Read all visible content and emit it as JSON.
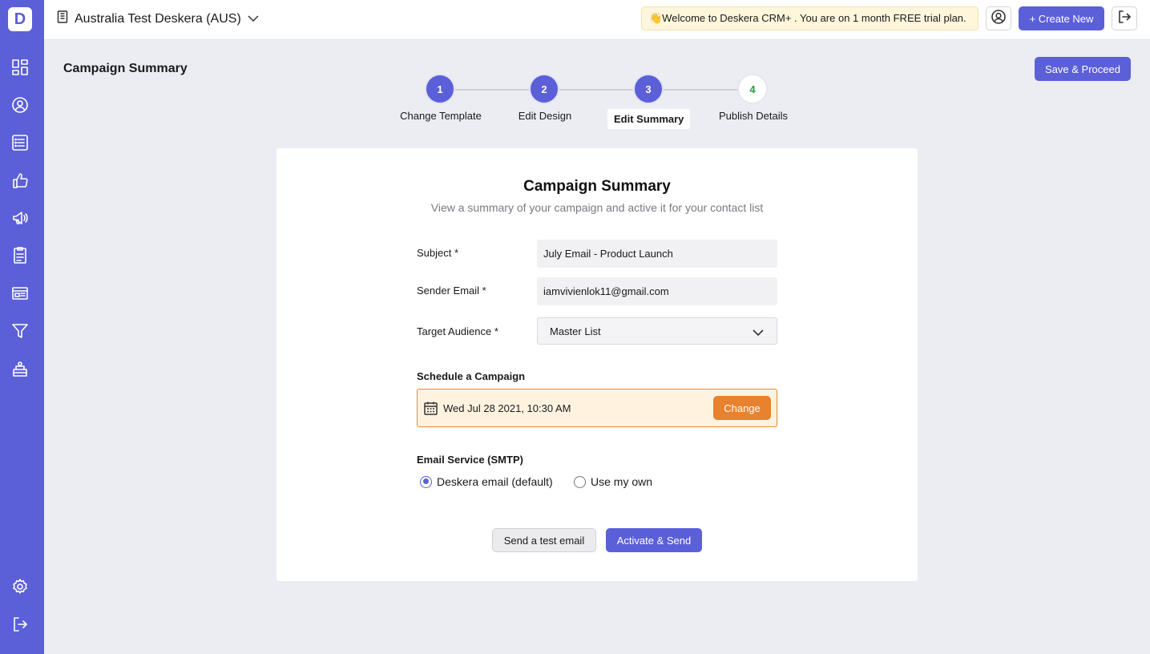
{
  "app": {
    "logo_letter": "D"
  },
  "sidebar": {
    "items": [
      {
        "name": "dashboard-icon"
      },
      {
        "name": "contacts-icon"
      },
      {
        "name": "list-icon"
      },
      {
        "name": "deals-icon"
      },
      {
        "name": "campaign-icon"
      },
      {
        "name": "forms-icon"
      },
      {
        "name": "landing-page-icon"
      },
      {
        "name": "funnel-icon"
      },
      {
        "name": "support-icon"
      },
      {
        "name": "settings-icon"
      },
      {
        "name": "logout-icon"
      }
    ]
  },
  "topbar": {
    "org_name": "Australia Test Deskera (AUS)",
    "banner": "👋Welcome to Deskera CRM+ . You are on 1 month FREE trial plan.",
    "create_label": "+ Create New"
  },
  "header": {
    "title": "Campaign Summary",
    "save_label": "Save & Proceed"
  },
  "stepper": {
    "steps": [
      {
        "num": "1",
        "label": "Change Template",
        "status": "done"
      },
      {
        "num": "2",
        "label": "Edit Design",
        "status": "done"
      },
      {
        "num": "3",
        "label": "Edit Summary",
        "status": "active"
      },
      {
        "num": "4",
        "label": "Publish Details",
        "status": "pending"
      }
    ]
  },
  "card": {
    "title": "Campaign Summary",
    "subtitle": "View a summary of your campaign and active it for your contact list",
    "fields": {
      "subject_label": "Subject *",
      "subject_value": "July Email  - Product Launch",
      "sender_label": "Sender Email *",
      "sender_value": "iamvivienlok11@gmail.com",
      "audience_label": "Target Audience *",
      "audience_value": "Master List"
    },
    "schedule": {
      "title": "Schedule a Campaign",
      "datetime": "Wed Jul 28 2021, 10:30 AM",
      "change_label": "Change"
    },
    "smtp": {
      "title": "Email Service (SMTP)",
      "options": [
        {
          "label": "Deskera email (default)",
          "checked": true
        },
        {
          "label": "Use my own",
          "checked": false
        }
      ]
    },
    "actions": {
      "test_label": "Send a test email",
      "activate_label": "Activate & Send"
    }
  },
  "colors": {
    "primary": "#5b5fd8",
    "accent_orange": "#e8822f",
    "banner_bg": "#fff6dc"
  }
}
